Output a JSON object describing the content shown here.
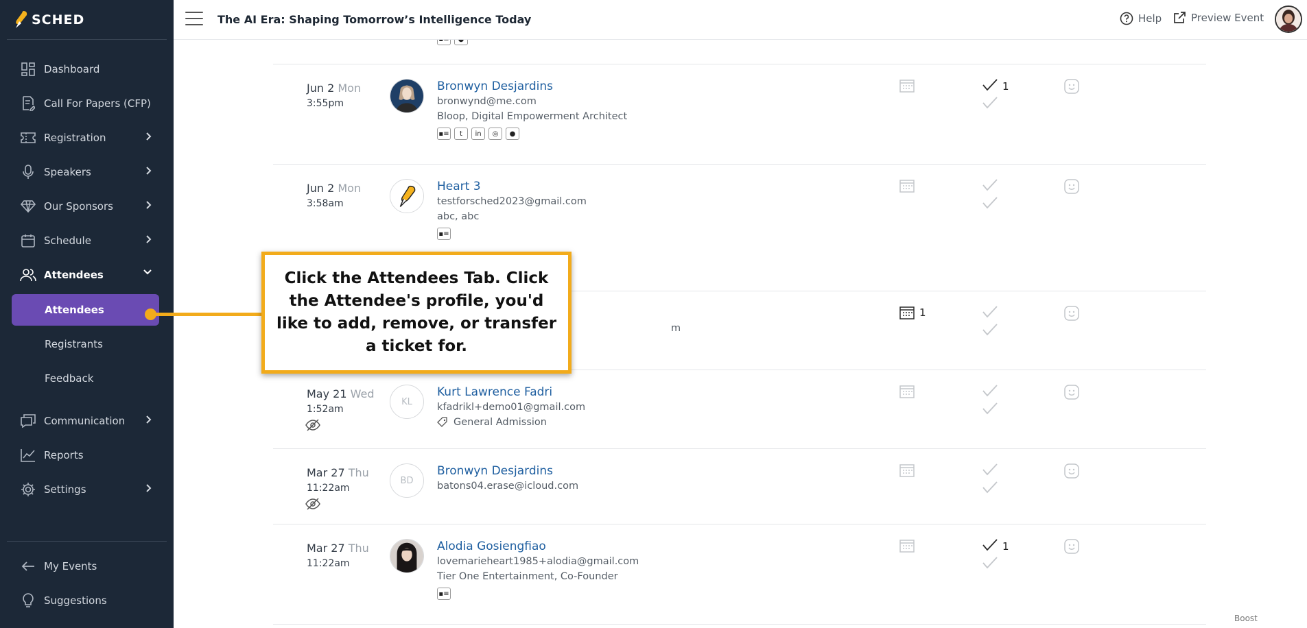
{
  "sidebar": {
    "logo_text": "SCHED",
    "items": [
      {
        "label": "Dashboard",
        "icon": "dashboard-icon"
      },
      {
        "label": "Call For Papers (CFP)",
        "icon": "document-edit-icon"
      },
      {
        "label": "Registration",
        "icon": "ticket-icon"
      },
      {
        "label": "Speakers",
        "icon": "microphone-icon"
      },
      {
        "label": "Our Sponsors",
        "icon": "diamond-icon"
      },
      {
        "label": "Schedule",
        "icon": "calendar-icon"
      },
      {
        "label": "Attendees",
        "icon": "users-icon"
      }
    ],
    "subitems": [
      {
        "label": "Attendees"
      },
      {
        "label": "Registrants"
      },
      {
        "label": "Feedback"
      }
    ],
    "items2": [
      {
        "label": "Communication",
        "icon": "chat-icon"
      },
      {
        "label": "Reports",
        "icon": "chart-line-icon"
      },
      {
        "label": "Settings",
        "icon": "gear-icon"
      }
    ],
    "footer": [
      {
        "label": "My Events",
        "icon": "arrow-left-icon"
      },
      {
        "label": "Suggestions",
        "icon": "lightbulb-icon"
      }
    ]
  },
  "header": {
    "title": "The AI Era: Shaping Tomorrow’s Intelligence Today",
    "help": "Help",
    "preview": "Preview Event"
  },
  "rows": [
    {
      "date": "Jun 2",
      "dow": "Mon",
      "time": "3:55pm",
      "name": "Bronwyn Desjardins",
      "email": "bronwynd@me.com",
      "org": "Bloop, Digital Empowerment Architect",
      "check_count": "1"
    },
    {
      "date": "Jun 2",
      "dow": "Mon",
      "time": "3:58am",
      "name": "Heart 3",
      "email": "testforsched2023@gmail.com",
      "org": "abc, abc"
    },
    {
      "cal_count": "1",
      "email_tail": "m"
    },
    {
      "date": "May 21",
      "dow": "Wed",
      "time": "1:52am",
      "initials": "KL",
      "name": "Kurt Lawrence Fadri",
      "email": "kfadrikl+demo01@gmail.com",
      "ticket": "General Admission"
    },
    {
      "date": "Mar 27",
      "dow": "Thu",
      "time": "11:22am",
      "initials": "BD",
      "name": "Bronwyn Desjardins",
      "email": "batons04.erase@icloud.com"
    },
    {
      "date": "Mar 27",
      "dow": "Thu",
      "time": "11:22am",
      "name": "Alodia Gosiengfiao",
      "email": "lovemarieheart1985+alodia@gmail.com",
      "org": "Tier One Entertainment, Co-Founder",
      "check_count": "1"
    }
  ],
  "callout": {
    "text": "Click the Attendees Tab. Click the Attendee's profile, you'd like to add, remove, or transfer a ticket for."
  },
  "boost": "Boost",
  "colors": {
    "sidebar_bg": "#1c2837",
    "active": "#6a4bb3",
    "callout_border": "#f2ab1b",
    "link": "#1f5fa0"
  }
}
